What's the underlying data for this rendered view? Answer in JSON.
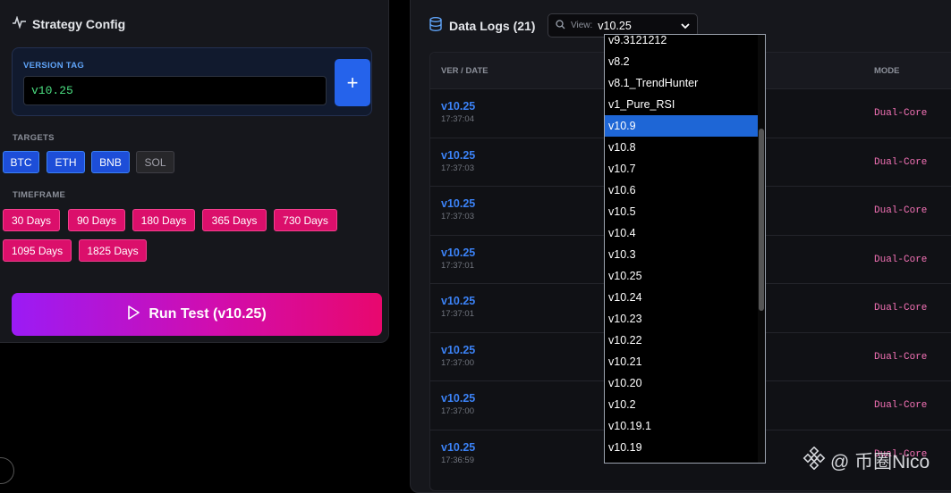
{
  "config": {
    "title": "Strategy Config",
    "version_label": "VERSION TAG",
    "version_value": "v10.25",
    "add_label": "+",
    "targets_label": "TARGETS",
    "targets": [
      {
        "label": "BTC",
        "active": true
      },
      {
        "label": "ETH",
        "active": true
      },
      {
        "label": "BNB",
        "active": true
      },
      {
        "label": "SOL",
        "active": false
      }
    ],
    "timeframe_label": "TIMEFRAME",
    "timeframes": [
      "30 Days",
      "90 Days",
      "180 Days",
      "365 Days",
      "730 Days",
      "1095 Days",
      "1825 Days"
    ],
    "run_label": "Run Test (v10.25)"
  },
  "logs": {
    "title": "Data Logs (21)",
    "view_label": "View:",
    "view_value": "v10.25",
    "headers": {
      "ver_date": "VER / DATE",
      "mode": "MODE"
    },
    "rows": [
      {
        "ver": "v10.25",
        "time": "17:37:04",
        "mode": "Dual-Core"
      },
      {
        "ver": "v10.25",
        "time": "17:37:03",
        "mode": "Dual-Core"
      },
      {
        "ver": "v10.25",
        "time": "17:37:03",
        "mode": "Dual-Core"
      },
      {
        "ver": "v10.25",
        "time": "17:37:01",
        "mode": "Dual-Core"
      },
      {
        "ver": "v10.25",
        "time": "17:37:01",
        "mode": "Dual-Core"
      },
      {
        "ver": "v10.25",
        "time": "17:37:00",
        "mode": "Dual-Core"
      },
      {
        "ver": "v10.25",
        "time": "17:37:00",
        "mode": "Dual-Core"
      },
      {
        "ver": "v10.25",
        "time": "17:36:59",
        "mode": "Dual-Core"
      }
    ]
  },
  "dropdown": {
    "options": [
      "v9.3121212",
      "v8.2",
      "v8.1_TrendHunter",
      "v1_Pure_RSI",
      "v10.9",
      "v10.8",
      "v10.7",
      "v10.6",
      "v10.5",
      "v10.4",
      "v10.3",
      "v10.25",
      "v10.24",
      "v10.23",
      "v10.22",
      "v10.21",
      "v10.20",
      "v10.2",
      "v10.19.1",
      "v10.19"
    ],
    "highlighted": "v10.9"
  },
  "watermark": {
    "text": "@ 币圈Nico"
  },
  "colors": {
    "accent_blue": "#2563eb",
    "accent_pink": "#db0f6b",
    "mode_pink": "#f472b6",
    "version_green": "#4ade80"
  }
}
